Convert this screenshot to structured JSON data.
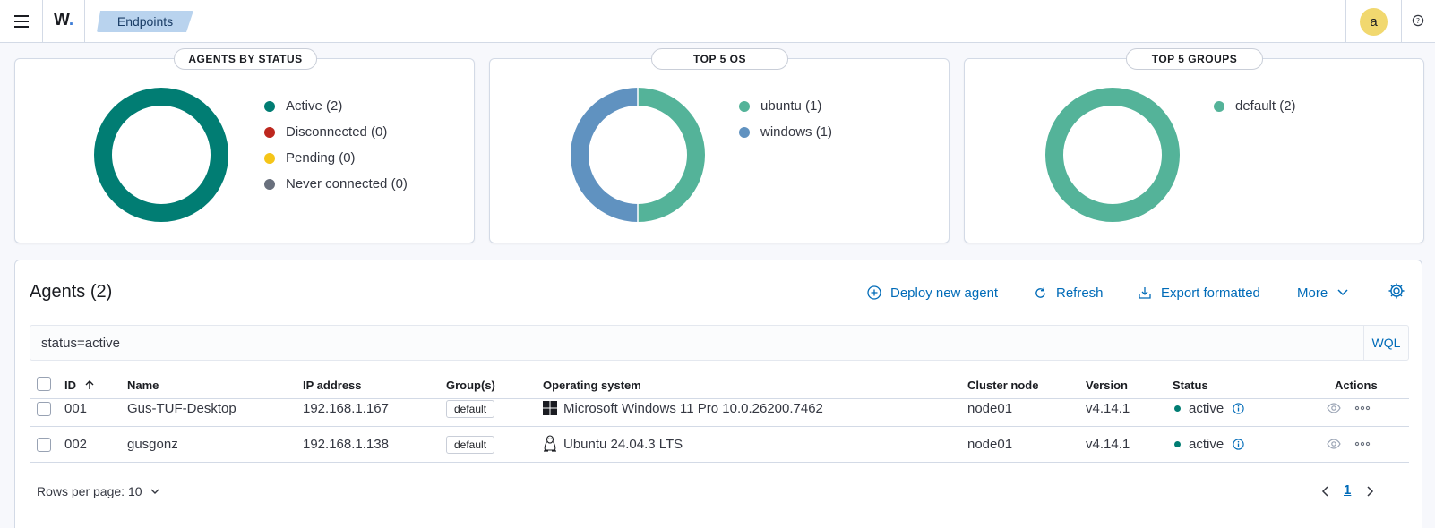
{
  "header": {
    "logo_text": "W",
    "logo_dot": ".",
    "breadcrumb": "Endpoints",
    "avatar_initial": "a"
  },
  "panels": [
    {
      "title": "AGENTS BY STATUS",
      "legend": [
        {
          "label": "Active (2)",
          "color": "#017d73",
          "value": 2
        },
        {
          "label": "Disconnected (0)",
          "color": "#bd271e",
          "value": 0
        },
        {
          "label": "Pending (0)",
          "color": "#f5c518",
          "value": 0
        },
        {
          "label": "Never connected (0)",
          "color": "#69707d",
          "value": 0
        }
      ]
    },
    {
      "title": "TOP 5 OS",
      "legend": [
        {
          "label": "ubuntu (1)",
          "color": "#54b399",
          "value": 1
        },
        {
          "label": "windows (1)",
          "color": "#6092c0",
          "value": 1
        }
      ]
    },
    {
      "title": "TOP 5 GROUPS",
      "legend": [
        {
          "label": "default (2)",
          "color": "#54b399",
          "value": 2
        }
      ]
    }
  ],
  "agents": {
    "title": "Agents (2)",
    "actions": {
      "deploy": "Deploy new agent",
      "refresh": "Refresh",
      "export": "Export formatted",
      "more": "More"
    },
    "search_value": "status=active",
    "wql": "WQL",
    "columns": {
      "id": "ID",
      "name": "Name",
      "ip": "IP address",
      "groups": "Group(s)",
      "os": "Operating system",
      "cluster": "Cluster node",
      "version": "Version",
      "status": "Status",
      "actions": "Actions"
    },
    "rows": [
      {
        "id": "001",
        "name": "Gus-TUF-Desktop",
        "ip": "192.168.1.167",
        "group": "default",
        "os_icon": "windows-icon",
        "os": "Microsoft Windows 11 Pro 10.0.26200.7462",
        "cluster": "node01",
        "version": "v4.14.1",
        "status": "active"
      },
      {
        "id": "002",
        "name": "gusgonz",
        "ip": "192.168.1.138",
        "group": "default",
        "os_icon": "linux-icon",
        "os": "Ubuntu 24.04.3 LTS",
        "cluster": "node01",
        "version": "v4.14.1",
        "status": "active"
      }
    ],
    "rows_per_page": "Rows per page: 10",
    "current_page": "1"
  }
}
